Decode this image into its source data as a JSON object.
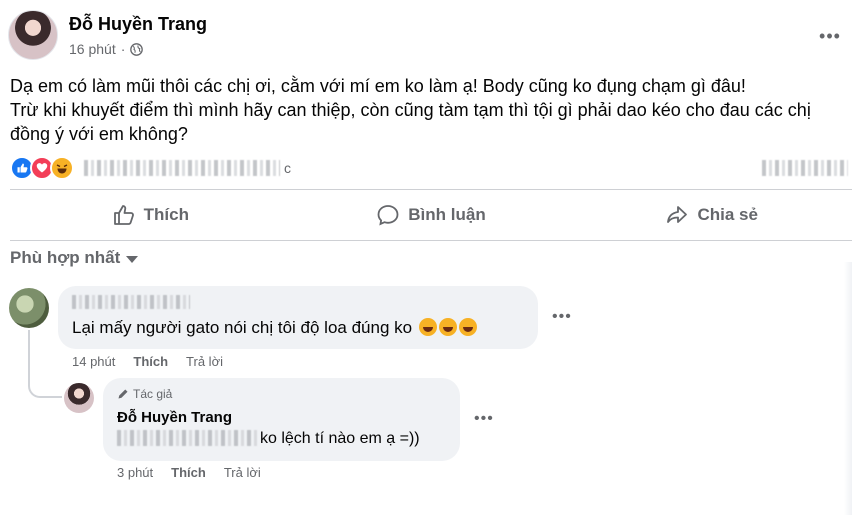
{
  "post": {
    "author": "Đỗ Huyền Trang",
    "time": "16 phút",
    "more_label": "•••",
    "text_lines": [
      "Dạ em có làm mũi thôi các chị ơi, cằm với mí em ko làm ạ! Body cũng ko đụng chạm gì đâu!",
      "Trừ khi khuyết điểm thì mình hãy can thiệp, còn cũng tàm tạm thì tội gì phải dao kéo cho đau các chị",
      "đồng ý với em không?"
    ],
    "reactions_suffix": "c"
  },
  "actions": {
    "like": "Thích",
    "comment": "Bình luận",
    "share": "Chia sẻ"
  },
  "sort": {
    "label": "Phù hợp nhất"
  },
  "comments": [
    {
      "text": "Lại mấy người gato nói chị tôi độ loa đúng ko",
      "time": "14 phút",
      "like": "Thích",
      "reply": "Trả lời",
      "more_label": "•••"
    }
  ],
  "reply": {
    "badge": "Tác giả",
    "author": "Đỗ Huyền Trang",
    "text": "ko lệch tí nào em ạ =))",
    "time": "3 phút",
    "like": "Thích",
    "reply": "Trả lời",
    "more_label": "•••"
  },
  "colors": {
    "primary_text": "#050505",
    "secondary_text": "#65676b",
    "bubble_bg": "#f0f2f5",
    "divider": "#ced0d4",
    "like_blue": "#1877f2",
    "love_red": "#f33e58",
    "haha_yellow": "#f7b125"
  }
}
